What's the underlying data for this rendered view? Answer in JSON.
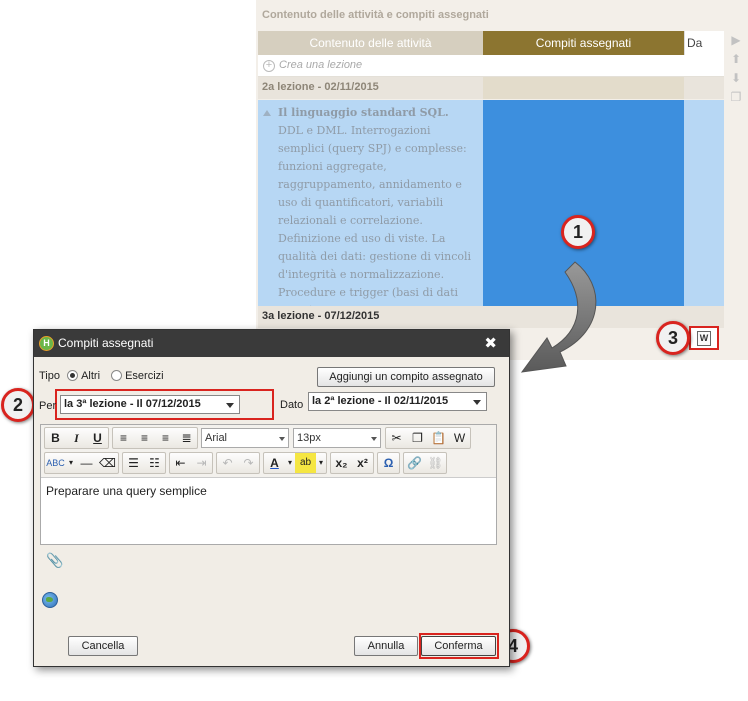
{
  "background": {
    "header": "Contenuto delle attività e compiti assegnati",
    "columns": [
      "Contenuto delle attività",
      "Compiti assegnati",
      "Da fare"
    ],
    "create_lesson": "Crea una lezione",
    "lesson2_title": "2a lezione - 02/11/2015",
    "lesson2_content_title": "Il linguaggio standard SQL.",
    "lesson2_content_body": "DDL e DML. Interrogazioni semplici (query SPJ) e complesse: funzioni aggregate, raggruppamento, annidamento e uso di quantificatori, variabili relazionali e correlazione. Definizione ed uso di viste. La qualità dei dati: gestione di vincoli d'integrità e normalizzazione. Procedure e trigger (basi di dati attive).",
    "lesson3_title": "3a lezione - 07/12/2015",
    "word_icon_glyph": "W",
    "colors": {
      "assigned_header": "#8c7530",
      "assigned_cell": "#3d8fde",
      "content_cell": "#b7d7f4",
      "callout_border": "#d9241f"
    }
  },
  "callouts": [
    "1",
    "2",
    "3",
    "4"
  ],
  "dialog": {
    "title": "Compiti assegnati",
    "logo_glyph": "H",
    "close_glyph": "✖",
    "tipo_label": "Tipo",
    "tipo_options": [
      "Altri",
      "Esercizi"
    ],
    "tipo_selected": "Altri",
    "add_button": "Aggiungi un compito assegnato",
    "per_label": "Per",
    "per_value": "la 3ª lezione - Il 07/12/2015",
    "dato_label": "Dato",
    "dato_value": "la 2ª lezione - Il 02/11/2015",
    "toolbar": {
      "bold": "B",
      "italic": "I",
      "underline": "U",
      "font": "Arial",
      "size": "13px",
      "text_color_glyph": "A",
      "subscript": "x₂",
      "superscript": "x²",
      "omega": "Ω"
    },
    "editor_text": "Preparare una query semplice",
    "cancel_button": "Cancella",
    "annulla_button": "Annulla",
    "confirm_button": "Conferma"
  }
}
